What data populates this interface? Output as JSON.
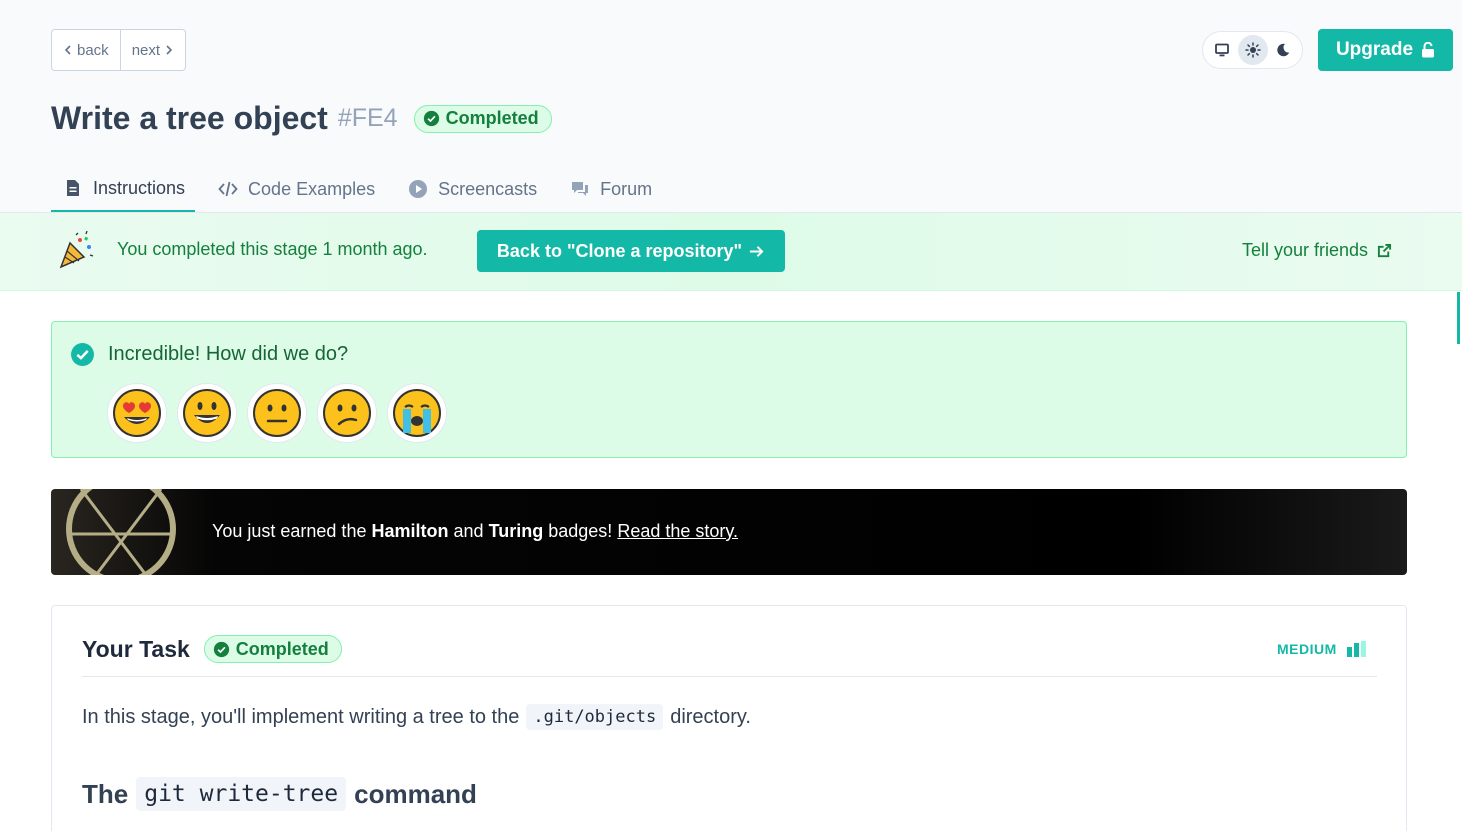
{
  "nav": {
    "back_label": "back",
    "next_label": "next"
  },
  "theme": {
    "options": [
      "system-icon",
      "sun-icon",
      "moon-icon"
    ],
    "selected": "light"
  },
  "upgrade": {
    "label": "Upgrade"
  },
  "stage": {
    "title": "Write a tree object",
    "code": "#FE4",
    "status": "Completed"
  },
  "tabs": [
    {
      "label": "Instructions",
      "icon": "document-icon",
      "active": true
    },
    {
      "label": "Code Examples",
      "icon": "code-icon",
      "active": false
    },
    {
      "label": "Screencasts",
      "icon": "play-icon",
      "active": false
    },
    {
      "label": "Forum",
      "icon": "chat-icon",
      "active": false
    }
  ],
  "completion_banner": {
    "message": "You completed this stage 1 month ago.",
    "back_button": "Back to \"Clone a repository\"",
    "tell_friends": "Tell your friends"
  },
  "feedback": {
    "question": "Incredible! How did we do?",
    "emojis": [
      "heart-eyes-emoji",
      "grinning-emoji",
      "neutral-emoji",
      "confused-emoji",
      "crying-emoji"
    ]
  },
  "badges_earned": {
    "prefix": "You just earned the",
    "badge1": "Hamilton",
    "and": "and",
    "badge2": "Turing",
    "suffix": "badges!",
    "link": "Read the story."
  },
  "task": {
    "title": "Your Task",
    "status": "Completed",
    "difficulty": "MEDIUM",
    "para_before": "In this stage, you'll implement writing a tree to the",
    "para_code": ".git/objects",
    "para_after": "directory.",
    "heading_prefix": "The",
    "heading_code": "git write-tree",
    "heading_suffix": "command"
  },
  "colors": {
    "accent": "#14b8a6",
    "success_bg": "#dcfce7",
    "success_text": "#15803d"
  }
}
